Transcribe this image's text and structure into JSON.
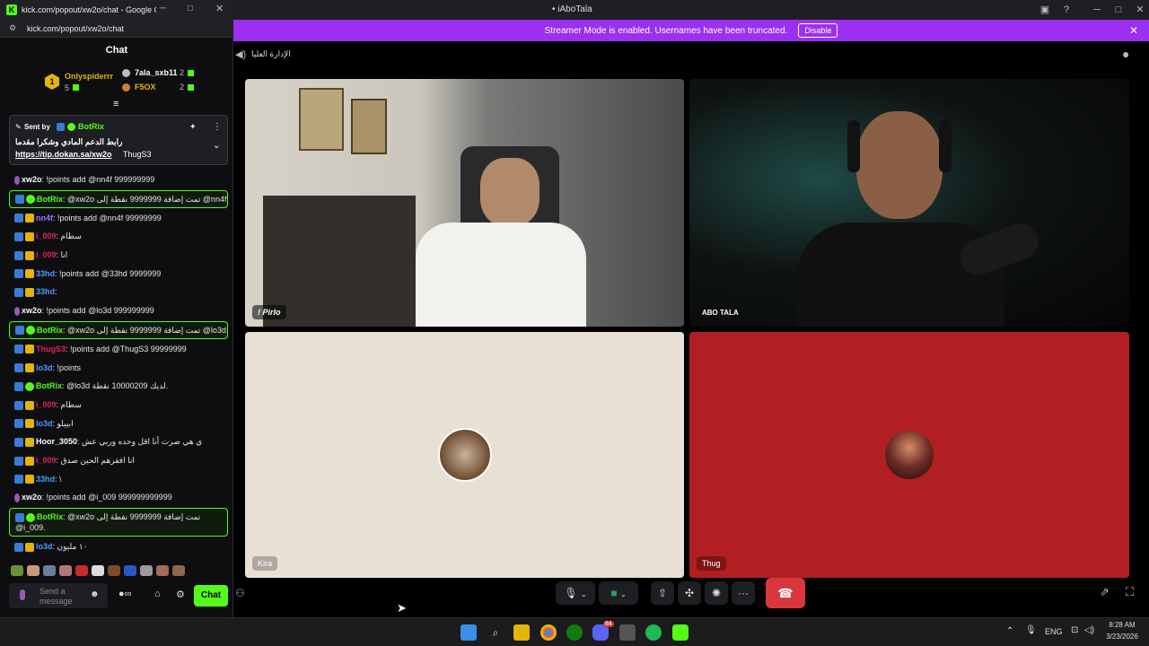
{
  "discord": {
    "window_title": "• iAboTala",
    "banner_text": "Streamer Mode is enabled. Usernames have been truncated.",
    "banner_button": "Disable",
    "channel_name": "الإدارة العليا",
    "tiles": [
      {
        "name": "! Pirlo"
      },
      {
        "name": "ABO TALA"
      },
      {
        "name": "Kira"
      },
      {
        "name": "Thug"
      }
    ],
    "colors": {
      "banner": "#9b30ef",
      "thug_tile": "#b21f22",
      "kira_tile": "#e8e0d3",
      "hangup": "#da373c"
    }
  },
  "popup": {
    "window_title": "kick.com/popout/xw2o/chat - Google C...",
    "url": "kick.com/popout/xw2o/chat",
    "chat_header": "Chat",
    "leaderboard": {
      "rank1": {
        "rank": "1",
        "name": "Onlyspiderrr",
        "count": "5"
      },
      "others": [
        {
          "name": "7ala_sxb11",
          "count": "2"
        },
        {
          "name": "F5OX",
          "count": "2"
        }
      ]
    },
    "pinned": {
      "sent_by_label": "Sent by",
      "sender": "BotRix",
      "line1": "رابط الدعم المادي وشكرا مقدما",
      "link": "https://tip.dokan.sa/xw2o",
      "suffix": "ThugS3"
    },
    "messages": [
      {
        "user": "xw2o",
        "user_color": "#ffffff",
        "text": "!points add @nn4f 999999999",
        "type": "mod"
      },
      {
        "user": "BotRix",
        "user_color": "#53fc18",
        "text": "@xw2o تمت إضافة 9999999 نقطة إلى @nn4f.",
        "type": "bot"
      },
      {
        "user": "nn4f",
        "user_color": "#8a7bff",
        "text": "!points add @nn4f 99999999",
        "type": "sub"
      },
      {
        "user": "i_009",
        "user_color": "#e0245e",
        "text": "سطام",
        "type": "sub"
      },
      {
        "user": "i_009",
        "user_color": "#e0245e",
        "text": "انا",
        "type": "sub"
      },
      {
        "user": "33hd",
        "user_color": "#4a9eff",
        "text": "!points add @33hd 9999999",
        "type": "sub"
      },
      {
        "user": "33hd",
        "user_color": "#4a9eff",
        "text": "",
        "type": "sub"
      },
      {
        "user": "xw2o",
        "user_color": "#ffffff",
        "text": "!points add @lo3d 999999999",
        "type": "mod"
      },
      {
        "user": "BotRix",
        "user_color": "#53fc18",
        "text": "@xw2o تمت إضافة 9999999 نقطة إلى @lo3d.",
        "type": "bot"
      },
      {
        "user": "ThugS3",
        "user_color": "#e0245e",
        "text": "!points add @ThugS3 99999999",
        "type": "sub"
      },
      {
        "user": "lo3d",
        "user_color": "#4a9eff",
        "text": "!points",
        "type": "sub"
      },
      {
        "user": "BotRix",
        "user_color": "#53fc18",
        "text": "@lo3d لديك 10000209 نقطة.",
        "type": "botplain"
      },
      {
        "user": "i_009",
        "user_color": "#e0245e",
        "text": "سطام",
        "type": "sub"
      },
      {
        "user": "lo3d",
        "user_color": "#4a9eff",
        "text": "ابييلو",
        "type": "sub"
      },
      {
        "user": "Hoor_3050",
        "user_color": "#ffffff",
        "text": "ي هي صرت أنا اقل وحده وربي عش",
        "type": "sub"
      },
      {
        "user": "i_009",
        "user_color": "#e0245e",
        "text": "انا افقرهم الحين صدق",
        "type": "sub"
      },
      {
        "user": "33hd",
        "user_color": "#4a9eff",
        "text": "\\",
        "type": "sub"
      },
      {
        "user": "xw2o",
        "user_color": "#ffffff",
        "text": "!points add @i_009 999999999999",
        "type": "mod"
      },
      {
        "user": "BotRix",
        "user_color": "#53fc18",
        "text": "@xw2o تمت إضافة 9999999 نقطة إلى @i_009.",
        "type": "bot2"
      },
      {
        "user": "lo3d",
        "user_color": "#4a9eff",
        "text": "١٠ مليون",
        "type": "sub"
      }
    ],
    "input_placeholder": "Send a message",
    "chat_button": "Chat",
    "colors": {
      "kick_green": "#53fc18"
    }
  },
  "taskbar": {
    "language": "ENG",
    "time": "8:28 AM",
    "date": "3/23/2026",
    "discord_badge": "84"
  }
}
